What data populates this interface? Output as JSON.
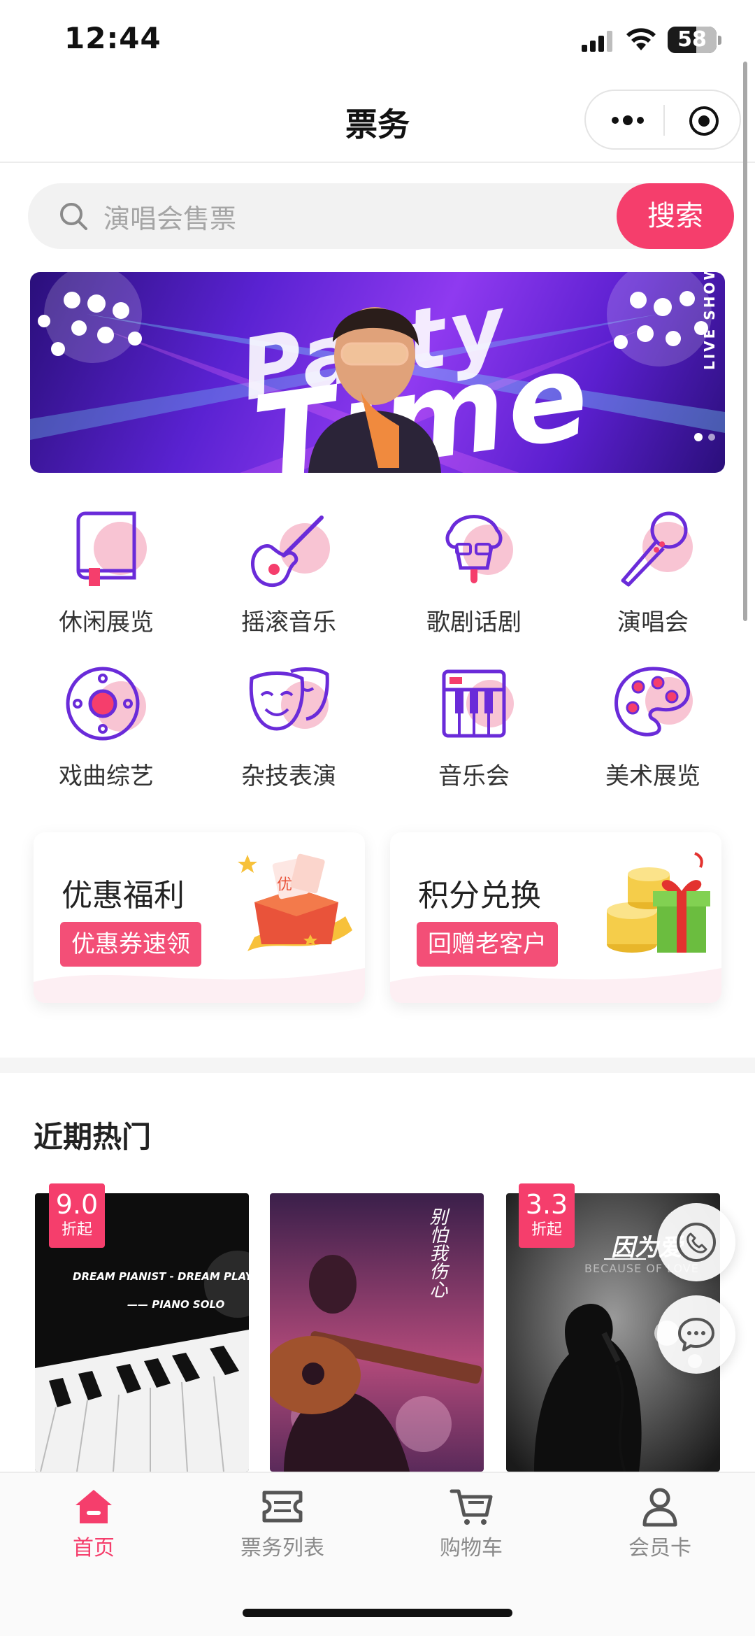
{
  "status_bar": {
    "time": "12:44",
    "battery": "58",
    "battery_level": 0.58
  },
  "nav": {
    "title": "票务"
  },
  "search": {
    "placeholder": "演唱会售票",
    "button": "搜索"
  },
  "banner": {
    "line1": "Party",
    "line2": "Time",
    "tag": "LIVE SHOW",
    "active_slide": 1,
    "slide_count": 2
  },
  "categories": [
    {
      "label": "休闲展览",
      "icon": "book-icon"
    },
    {
      "label": "摇滚音乐",
      "icon": "guitar-icon"
    },
    {
      "label": "歌剧话剧",
      "icon": "opera-icon"
    },
    {
      "label": "演唱会",
      "icon": "microphone-icon"
    },
    {
      "label": "戏曲综艺",
      "icon": "drum-icon"
    },
    {
      "label": "杂技表演",
      "icon": "masks-icon"
    },
    {
      "label": "音乐会",
      "icon": "keyboard-icon"
    },
    {
      "label": "美术展览",
      "icon": "palette-icon"
    }
  ],
  "promos": [
    {
      "title": "优惠福利",
      "tag": "优惠券速领",
      "art_text": "优"
    },
    {
      "title": "积分兑换",
      "tag": "回赠老客户"
    }
  ],
  "hot": {
    "title": "近期热门",
    "items": [
      {
        "badge_value": "9.0",
        "badge_suffix": "折起",
        "line1": "DREAM PIANIST - DREAM PLAY",
        "line2": "—— PIANO SOLO"
      },
      {
        "lines": "别怕我伤心"
      },
      {
        "badge_value": "3.3",
        "badge_suffix": "折起",
        "title": "因为爱",
        "subtitle": "BECAUSE OF LOVE"
      }
    ]
  },
  "tabs": [
    {
      "label": "首页",
      "icon": "home-icon",
      "active": true
    },
    {
      "label": "票务列表",
      "icon": "ticket-icon",
      "active": false
    },
    {
      "label": "购物车",
      "icon": "cart-icon",
      "active": false
    },
    {
      "label": "会员卡",
      "icon": "user-icon",
      "active": false
    }
  ],
  "colors": {
    "accent": "#f53e6c",
    "icon_purple": "#6a2bd9",
    "icon_pink": "#f8c4d3"
  }
}
